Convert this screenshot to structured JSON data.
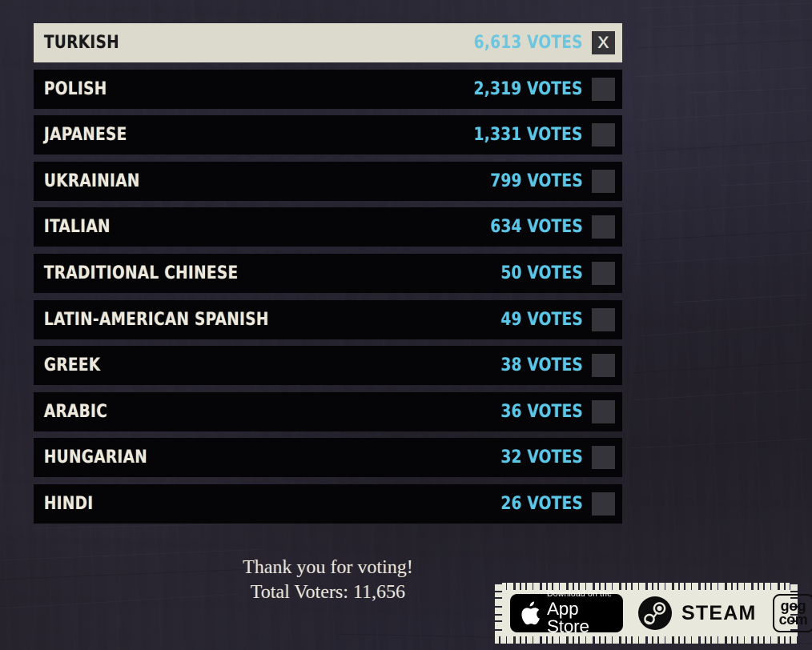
{
  "colors": {
    "background": "#2a2833",
    "row_background": "#050406",
    "row_selected_background": "#dcdacd",
    "label_text": "#eee8da",
    "votes_accent": "#5cc6e6",
    "checkbox": "#35343a",
    "badge_bar": "#e9e8dd"
  },
  "results": {
    "rows": [
      {
        "label": "TURKISH",
        "votes_text": "6,613 VOTES",
        "votes": 6613,
        "selected": true,
        "checkmark": "X"
      },
      {
        "label": "POLISH",
        "votes_text": "2,319 VOTES",
        "votes": 2319,
        "selected": false,
        "checkmark": ""
      },
      {
        "label": "JAPANESE",
        "votes_text": "1,331 VOTES",
        "votes": 1331,
        "selected": false,
        "checkmark": ""
      },
      {
        "label": "UKRAINIAN",
        "votes_text": "799 VOTES",
        "votes": 799,
        "selected": false,
        "checkmark": ""
      },
      {
        "label": "ITALIAN",
        "votes_text": "634 VOTES",
        "votes": 634,
        "selected": false,
        "checkmark": ""
      },
      {
        "label": "TRADITIONAL CHINESE",
        "votes_text": "50 VOTES",
        "votes": 50,
        "selected": false,
        "checkmark": ""
      },
      {
        "label": "LATIN-AMERICAN SPANISH",
        "votes_text": "49 VOTES",
        "votes": 49,
        "selected": false,
        "checkmark": ""
      },
      {
        "label": "GREEK",
        "votes_text": "38 VOTES",
        "votes": 38,
        "selected": false,
        "checkmark": ""
      },
      {
        "label": "ARABIC",
        "votes_text": "36 VOTES",
        "votes": 36,
        "selected": false,
        "checkmark": ""
      },
      {
        "label": "HUNGARIAN",
        "votes_text": "32 VOTES",
        "votes": 32,
        "selected": false,
        "checkmark": ""
      },
      {
        "label": "HINDI",
        "votes_text": "26 VOTES",
        "votes": 26,
        "selected": false,
        "checkmark": ""
      }
    ]
  },
  "footer": {
    "thanks": "Thank you for voting!",
    "total_label": "Total Voters: ",
    "total_value": "11,656"
  },
  "store_badges": {
    "appstore": {
      "top_line": "Download on the",
      "main_line": "App Store",
      "icon": "apple-icon"
    },
    "steam": {
      "label": "STEAM",
      "icon": "steam-icon"
    },
    "gog": {
      "line1": "gog",
      "line2": "com"
    }
  }
}
